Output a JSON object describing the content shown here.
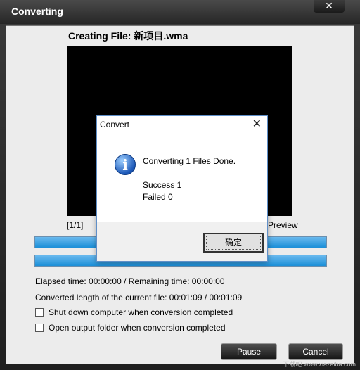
{
  "window": {
    "title": "Converting",
    "close_glyph": "✕"
  },
  "status": {
    "creating_label": "Creating File: 新项目.wma",
    "counter": "[1/1]",
    "preview_label": "Preview",
    "progress_file": 1.0,
    "progress_total": 1.0
  },
  "info": {
    "elapsed": "Elapsed time:  00:00:00 / Remaining time:  00:00:00",
    "converted": "Converted length of the current file:  00:01:09 / 00:01:09"
  },
  "options": {
    "shutdown": "Shut down computer when conversion completed",
    "open_folder": "Open output folder when conversion completed"
  },
  "buttons": {
    "pause": "Pause",
    "cancel": "Cancel"
  },
  "dialog": {
    "title": "Convert",
    "close_glyph": "✕",
    "message": "Converting 1 Files Done.",
    "success": "Success 1",
    "failed": "Failed 0",
    "ok_label": "确定"
  },
  "watermark": "下载吧 www.xiazaiba.com",
  "colors": {
    "progress_fill": "#1b8fd8",
    "dialog_border": "#5f8fc8"
  }
}
